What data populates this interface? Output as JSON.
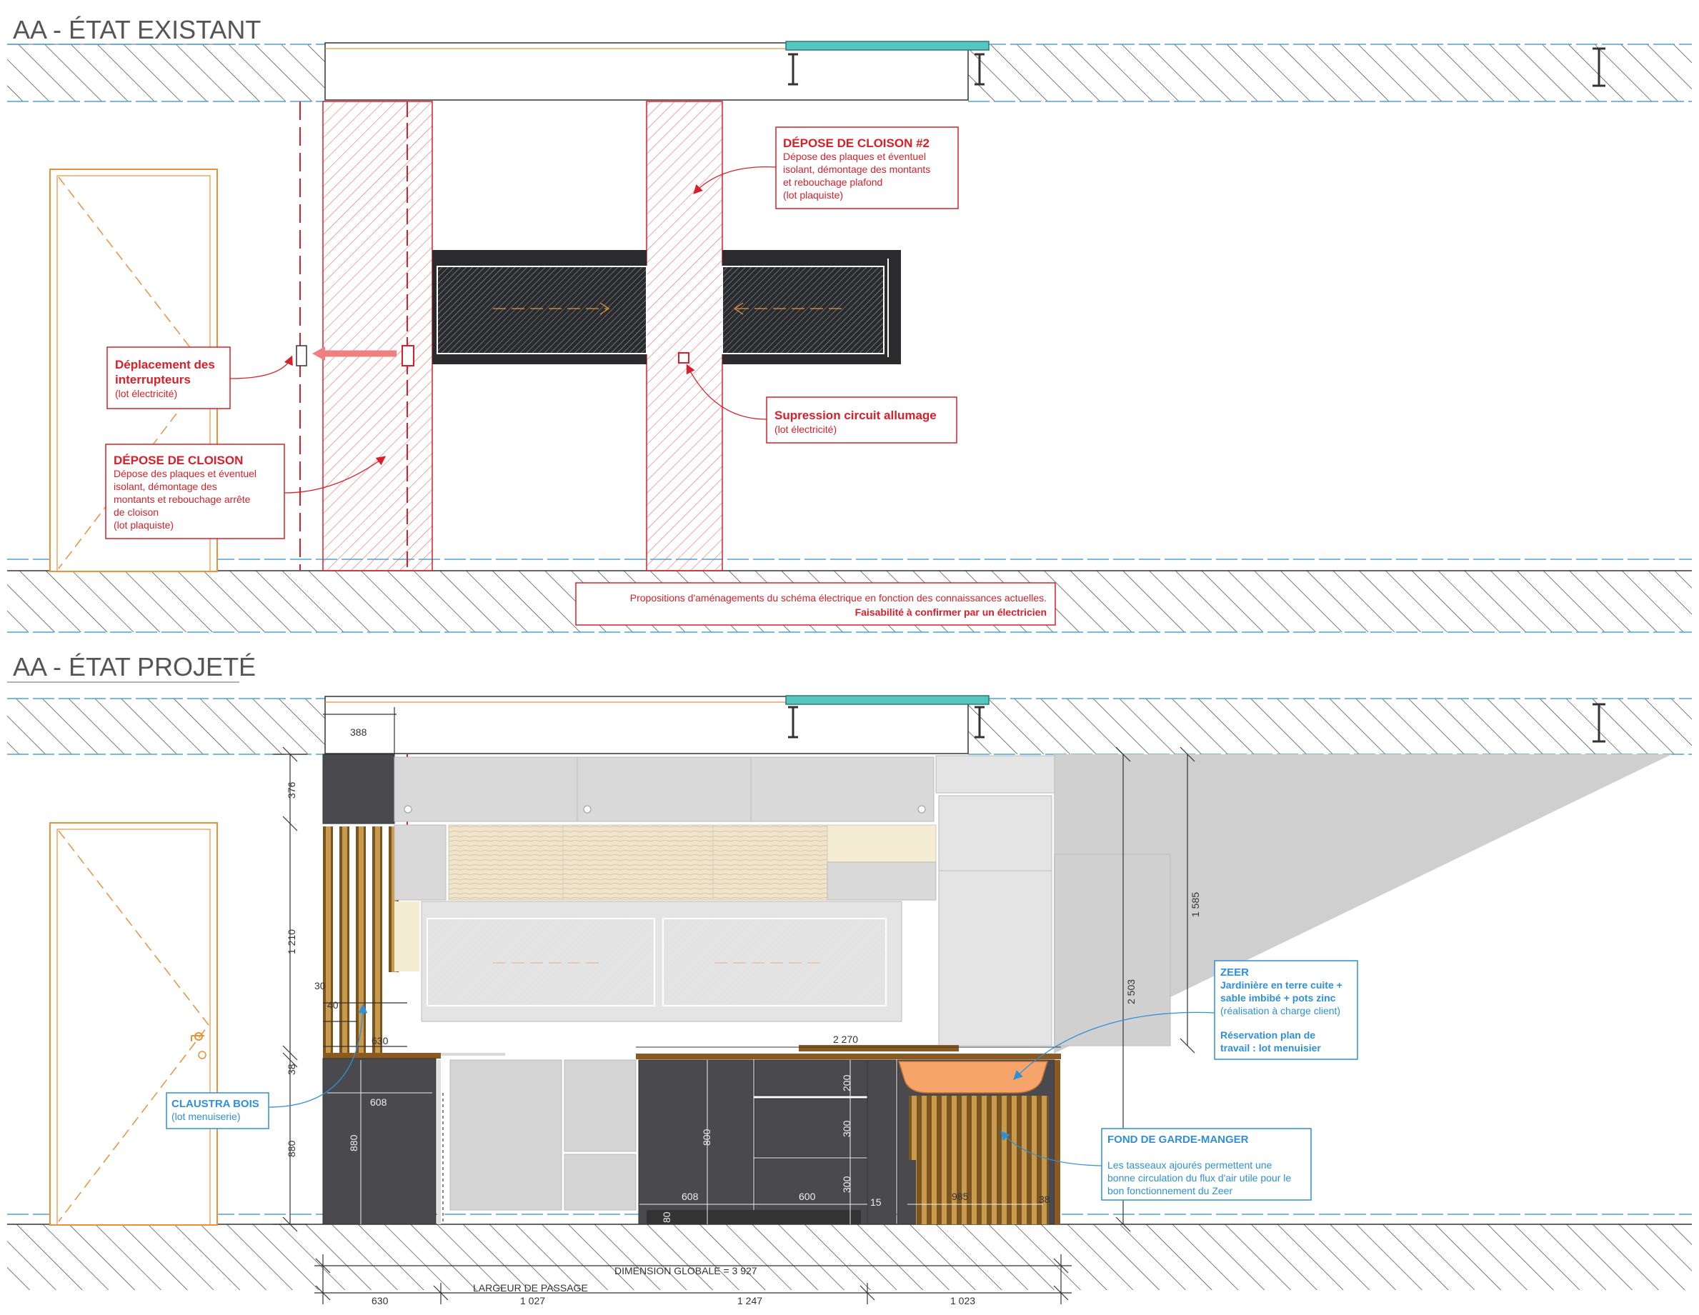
{
  "sections": {
    "existing_title": "AA - ÉTAT EXISTANT",
    "projected_title": "AA - ÉTAT PROJETÉ"
  },
  "existing": {
    "annotations": {
      "depose2": {
        "title": "DÉPOSE DE CLOISON #2",
        "lines": [
          "Dépose des plaques et éventuel",
          "isolant, démontage des montants",
          "et rebouchage plafond",
          "(lot plaquiste)"
        ]
      },
      "interrupteurs": {
        "title_lines": [
          "Déplacement des",
          "interrupteurs"
        ],
        "lines": [
          "(lot électricité)"
        ]
      },
      "depose1": {
        "title": "DÉPOSE DE CLOISON",
        "lines": [
          "Dépose des plaques et éventuel",
          "isolant, démontage des",
          "montants et rebouchage arrête",
          "de cloison",
          "(lot plaquiste)"
        ]
      },
      "allumage": {
        "title": "Supression circuit allumage",
        "lines": [
          "(lot électricité)"
        ]
      }
    },
    "note": {
      "line1": "Propositions d'aménagements du schéma électrique en fonction des connaissances actuelles.",
      "line2": "Faisabilité à confirmer par un électricien"
    }
  },
  "projected": {
    "annotations": {
      "zeer": {
        "title": "ZEER",
        "bold_lines": [
          "Jardinière en terre cuite +",
          "sable imbibé + pots zinc"
        ],
        "light_line": "(réalisation à charge client)",
        "bold2_lines": [
          "Réservation plan de",
          "travail : lot menuisier"
        ]
      },
      "claustra": {
        "title": "CLAUSTRA BOIS",
        "lines": [
          "(lot menuiserie)"
        ]
      },
      "garde_manger": {
        "title": "FOND DE GARDE-MANGER",
        "lines": [
          "Les tasseaux ajourés permettent une",
          "bonne circulation du flux d'air utile pour le",
          "bon fonctionnement du Zeer"
        ]
      }
    },
    "dimensions": {
      "d388": "388",
      "d376": "376",
      "d1210": "1 210",
      "d30": "30",
      "d40": "40",
      "d630_top": "630",
      "d38_left": "38",
      "d880_left": "880",
      "d608_a": "608",
      "d880_in": "880",
      "d2270": "2 270",
      "d200": "200",
      "d800": "800",
      "d300_a": "300",
      "d300_b": "300",
      "d608_b": "608",
      "d600": "600",
      "d15": "15",
      "d985": "985",
      "d38_right": "38",
      "d80": "80",
      "d1585": "1 585",
      "d2503": "2 503",
      "global": "DIMENSION GLOBALE = 3 927",
      "passage": "LARGEUR DE PASSAGE",
      "b630": "630",
      "b1027": "1 027",
      "b1247": "1 247",
      "b1023": "1 023"
    }
  },
  "colors": {
    "red": "#d8202a",
    "blue": "#2f8fd8",
    "orange": "#e8923a",
    "dark_cabinet": "#4a4a4e",
    "light_cabinet": "#d4d4d4",
    "wood": "#b07a2a",
    "hatch": "#333333"
  }
}
